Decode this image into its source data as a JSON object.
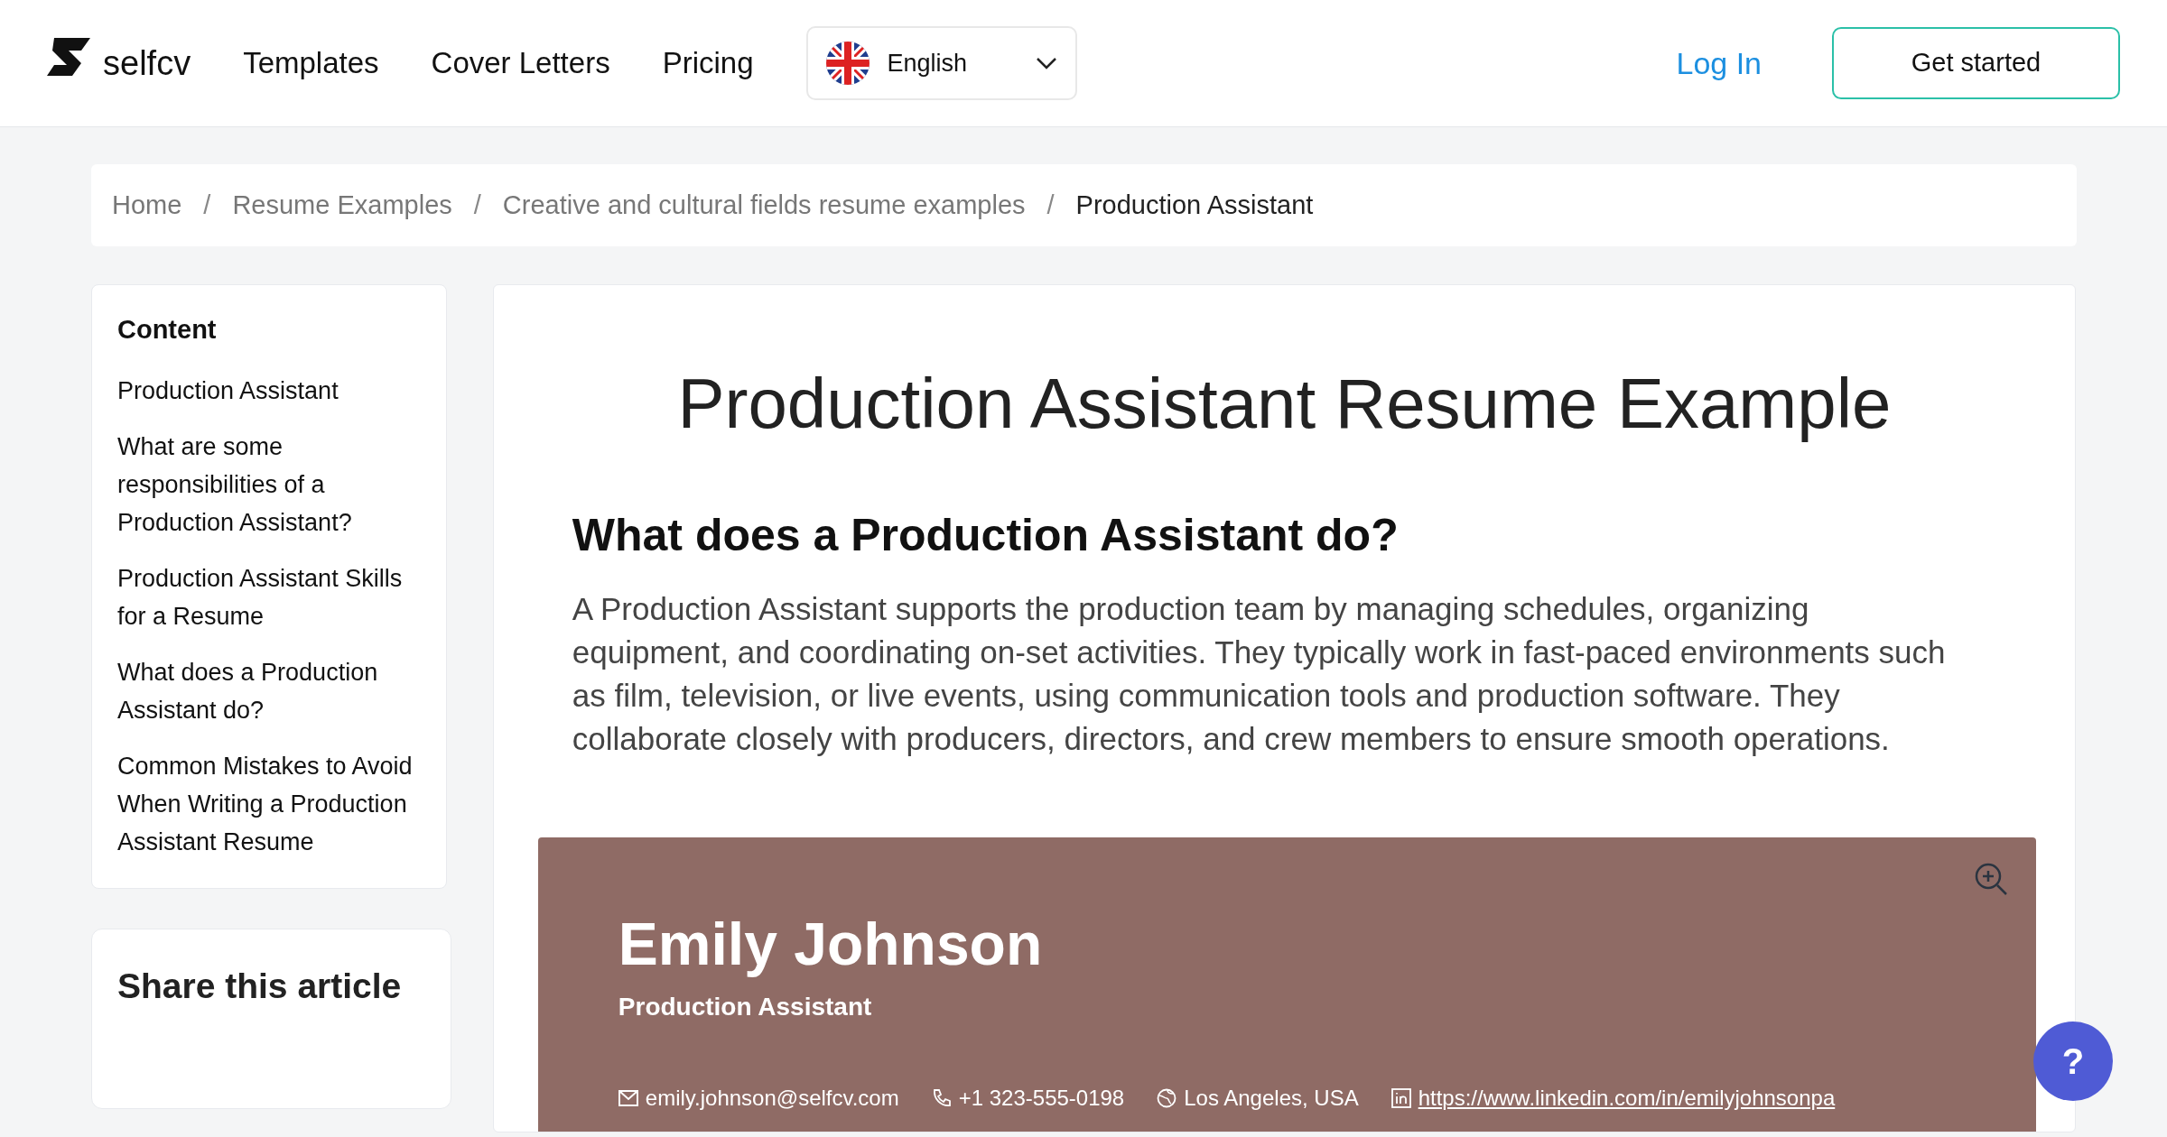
{
  "header": {
    "logo": "selfcv",
    "nav": [
      "Templates",
      "Cover Letters",
      "Pricing"
    ],
    "language": "English",
    "login": "Log In",
    "cta": "Get started"
  },
  "breadcrumb": [
    {
      "label": "Home",
      "current": false
    },
    {
      "separator": "/",
      "label": "Resume Examples",
      "current": false
    },
    {
      "separator": "/",
      "label": "Creative and cultural fields resume examples",
      "current": false
    },
    {
      "separator": "/",
      "label": "Production Assistant",
      "current": true
    }
  ],
  "sidebar": {
    "title": "Content",
    "items": [
      "Production Assistant",
      "What are some responsibilities of a Production Assistant?",
      "Production Assistant Skills for a Resume",
      "What does a Production Assistant do?",
      "Common Mistakes to Avoid When Writing a Production Assistant Resume"
    ],
    "share_title": "Share this article"
  },
  "article": {
    "title": "Production Assistant Resume Example",
    "heading": "What does a Production Assistant do?",
    "paragraph": "A Production Assistant supports the production team by managing schedules, organizing equipment, and coordinating on-set activities. They typically work in fast-paced environments such as film, television, or live events, using communication tools and production software. They collaborate closely with producers, directors, and crew members to ensure smooth operations."
  },
  "resume": {
    "name": "Emily Johnson",
    "role": "Production Assistant",
    "contacts": [
      {
        "kind": "email",
        "text": "emily.johnson@selfcv.com"
      },
      {
        "kind": "phone",
        "text": "+1 323-555-0198"
      },
      {
        "kind": "location",
        "text": "Los Angeles, USA"
      },
      {
        "kind": "linkedin",
        "text": "https://www.linkedin.com/in/emilyjohnsonpa"
      }
    ]
  },
  "help_button": "?"
}
